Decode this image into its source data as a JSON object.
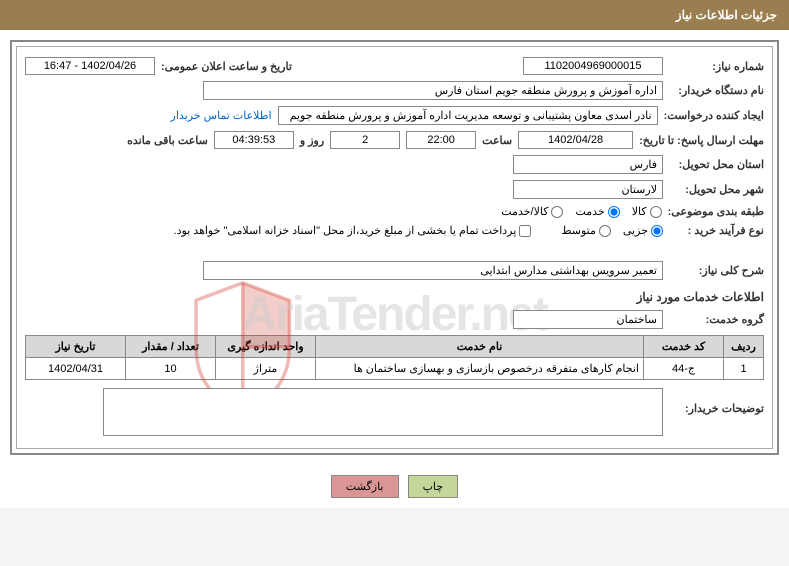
{
  "header_title": "جزئیات اطلاعات نیاز",
  "need_number_label": "شماره نیاز:",
  "need_number": "1102004969000015",
  "announce_label": "تاریخ و ساعت اعلان عمومی:",
  "announce_value": "1402/04/26 - 16:47",
  "buyer_org_label": "نام دستگاه خریدار:",
  "buyer_org": "اداره آموزش و پرورش منطقه جویم استان فارس",
  "requester_label": "ایجاد کننده درخواست:",
  "requester": "نادر اسدی معاون پشتیبانی و توسعه مدیریت اداره آموزش و پرورش منطقه جویم",
  "contact_link": "اطلاعات تماس خریدار",
  "deadline_label": "مهلت ارسال پاسخ: تا تاریخ:",
  "deadline_date": "1402/04/28",
  "hour_label": "ساعت",
  "deadline_hour": "22:00",
  "days_value": "2",
  "days_and": "روز و",
  "countdown": "04:39:53",
  "remaining_label": "ساعت باقی مانده",
  "province_label": "استان محل تحویل:",
  "province": "فارس",
  "city_label": "شهر محل تحویل:",
  "city": "لارستان",
  "category_label": "طبقه بندی موضوعی:",
  "cat_goods": "کالا",
  "cat_service": "خدمت",
  "cat_goods_service": "کالا/خدمت",
  "process_label": "نوع فرآیند خرید :",
  "proc_minor": "جزیی",
  "proc_medium": "متوسط",
  "payment_note": "پرداخت تمام یا بخشی از مبلغ خرید،از محل \"اسناد خزانه اسلامی\" خواهد بود.",
  "need_desc_label": "شرح کلی نیاز:",
  "need_desc": "تعمیر سرویس بهداشتی مدارس ابتدایی",
  "services_title": "اطلاعات خدمات مورد نیاز",
  "service_group_label": "گروه خدمت:",
  "service_group": "ساختمان",
  "table_headers": {
    "row": "ردیف",
    "code": "کد خدمت",
    "name": "نام خدمت",
    "unit": "واحد اندازه گیری",
    "qty": "تعداد / مقدار",
    "date": "تاریخ نیاز"
  },
  "table_rows": [
    {
      "row": "1",
      "code": "ج-44",
      "name": "انجام کارهای متفرقه درخصوص بازسازی و بهسازی ساختمان ها",
      "unit": "متراژ",
      "qty": "10",
      "date": "1402/04/31"
    }
  ],
  "buyer_notes_label": "توضیحات خریدار:",
  "btn_print": "چاپ",
  "btn_back": "بازگشت",
  "watermark": "AriaTender.net"
}
